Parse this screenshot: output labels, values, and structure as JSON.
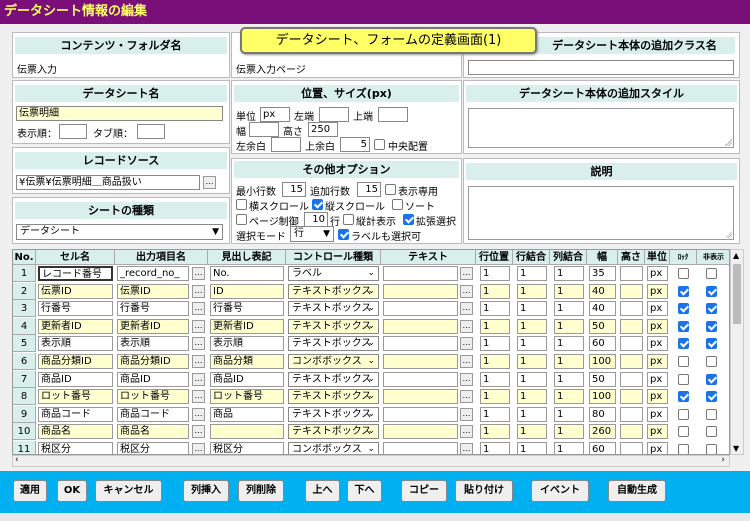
{
  "window": {
    "title": "データシート情報の編集"
  },
  "tooltip": "データシート、フォームの定義画面(1)",
  "content_folder": {
    "header": "コンテンツ・フォルダ名",
    "value": "伝票入力"
  },
  "datasheet": {
    "header": "データシート名",
    "name": "伝票明細",
    "order_label": "表示順：",
    "tab_label": "タブ順："
  },
  "record_source": {
    "header": "レコードソース",
    "value": "¥伝票¥伝票明細＿商品扱い"
  },
  "sheet_type": {
    "header": "シートの種類",
    "value": "データシート"
  },
  "form_title": {
    "value": "伝票入力ページ"
  },
  "position": {
    "header": "位置、サイズ(px)",
    "unit_label": "単位",
    "unit": "px",
    "left_label": "左端",
    "top_label": "上端",
    "width_label": "幅",
    "height_label": "高さ",
    "height": "250",
    "lmargin_label": "左余白",
    "tmargin_label": "上余白",
    "tmargin": "5",
    "center_label": "中央配置"
  },
  "options": {
    "header": "その他オプション",
    "min_rows_label": "最小行数",
    "min_rows": "15",
    "add_rows_label": "追加行数",
    "add_rows": "15",
    "display_only": "表示専用",
    "hscroll": "横スクロール",
    "vscroll": "縦スクロール",
    "sort": "ソート",
    "page_ctrl": "ページ制御",
    "page_rows": "10",
    "rows_label": "行",
    "vertical": "縦計表示",
    "ext_select": "拡張選択",
    "select_mode_label": "選択モード",
    "select_mode": "行",
    "label_selectable": "ラベルも選択可"
  },
  "add_class": {
    "header": "データシート本体の追加クラス名"
  },
  "add_style": {
    "header": "データシート本体の追加スタイル"
  },
  "description": {
    "header": "説明"
  },
  "grid": {
    "headers": [
      "No.",
      "セル名",
      "出力項目名",
      "見出し表記",
      "コントロール種類",
      "テキスト",
      "行位置",
      "行結合",
      "列結合",
      "幅",
      "高さ",
      "単位",
      "ﾛｯｸ",
      "非表示"
    ],
    "rows": [
      {
        "no": "1",
        "cell": "レコード番号",
        "field": "_record_no_",
        "caption": "No.",
        "control": "ラベル",
        "row": "1",
        "rowspan": "1",
        "colspan": "1",
        "width": "35",
        "unit": "px",
        "lock": false,
        "hide": false
      },
      {
        "no": "2",
        "cell": "伝票ID",
        "field": "伝票ID",
        "caption": "ID",
        "control": "テキストボックス",
        "row": "1",
        "rowspan": "1",
        "colspan": "1",
        "width": "40",
        "unit": "px",
        "lock": true,
        "hide": true
      },
      {
        "no": "3",
        "cell": "行番号",
        "field": "行番号",
        "caption": "行番号",
        "control": "テキストボックス",
        "row": "1",
        "rowspan": "1",
        "colspan": "1",
        "width": "40",
        "unit": "px",
        "lock": true,
        "hide": true
      },
      {
        "no": "4",
        "cell": "更新者ID",
        "field": "更新者ID",
        "caption": "更新者ID",
        "control": "テキストボックス",
        "row": "1",
        "rowspan": "1",
        "colspan": "1",
        "width": "50",
        "unit": "px",
        "lock": true,
        "hide": true
      },
      {
        "no": "5",
        "cell": "表示順",
        "field": "表示順",
        "caption": "表示順",
        "control": "テキストボックス",
        "row": "1",
        "rowspan": "1",
        "colspan": "1",
        "width": "60",
        "unit": "px",
        "lock": true,
        "hide": true
      },
      {
        "no": "6",
        "cell": "商品分類ID",
        "field": "商品分類ID",
        "caption": "商品分類",
        "control": "コンボボックス",
        "row": "1",
        "rowspan": "1",
        "colspan": "1",
        "width": "100",
        "unit": "px",
        "lock": false,
        "hide": false
      },
      {
        "no": "7",
        "cell": "商品ID",
        "field": "商品ID",
        "caption": "商品ID",
        "control": "テキストボックス",
        "row": "1",
        "rowspan": "1",
        "colspan": "1",
        "width": "50",
        "unit": "px",
        "lock": false,
        "hide": true
      },
      {
        "no": "8",
        "cell": "ロット番号",
        "field": "ロット番号",
        "caption": "ロット番号",
        "control": "テキストボックス",
        "row": "1",
        "rowspan": "1",
        "colspan": "1",
        "width": "100",
        "unit": "px",
        "lock": true,
        "hide": true
      },
      {
        "no": "9",
        "cell": "商品コード",
        "field": "商品コード",
        "caption": "商品",
        "control": "テキストボックス",
        "row": "1",
        "rowspan": "1",
        "colspan": "1",
        "width": "80",
        "unit": "px",
        "lock": false,
        "hide": false
      },
      {
        "no": "10",
        "cell": "商品名",
        "field": "商品名",
        "caption": "",
        "control": "テキストボックス",
        "row": "1",
        "rowspan": "1",
        "colspan": "1",
        "width": "260",
        "unit": "px",
        "lock": false,
        "hide": false
      },
      {
        "no": "11",
        "cell": "税区分",
        "field": "税区分",
        "caption": "税区分",
        "control": "コンボボックス",
        "row": "1",
        "rowspan": "1",
        "colspan": "1",
        "width": "60",
        "unit": "px",
        "lock": false,
        "hide": false
      }
    ]
  },
  "toolbar": {
    "apply": "適用",
    "ok": "OK",
    "cancel": "キャンセル",
    "insert_col": "列挿入",
    "delete_col": "列削除",
    "up": "上へ",
    "down": "下へ",
    "copy": "コピー",
    "paste": "貼り付け",
    "event": "イベント",
    "autogen": "自動生成"
  }
}
